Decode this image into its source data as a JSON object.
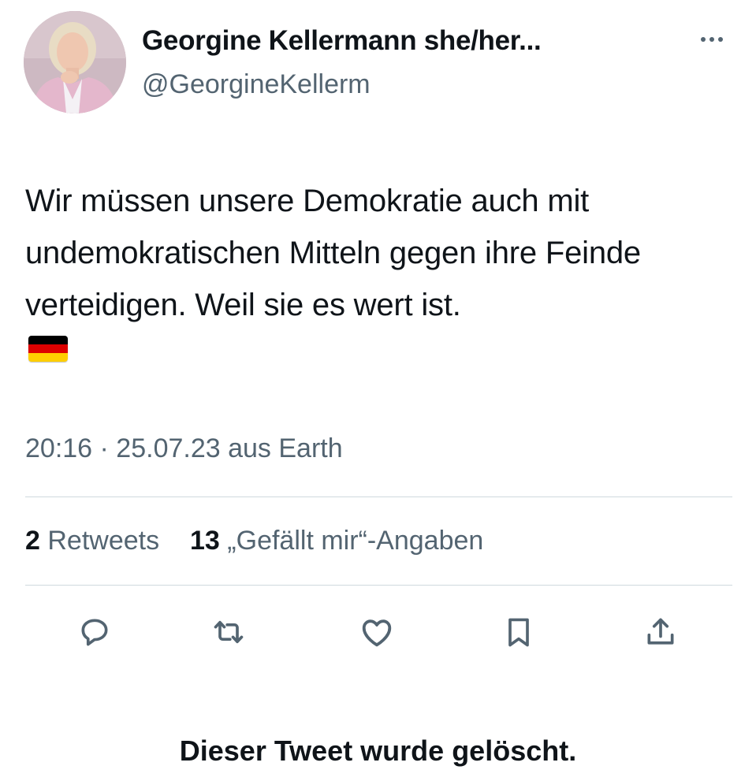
{
  "user": {
    "display_name": "Georgine Kellermann she/her...",
    "handle": "@GeorgineKellerm"
  },
  "tweet": {
    "text": "Wir müssen unsere Demokratie auch mit undemokratischen Mitteln gegen ihre Feinde verteidigen. Weil sie es wert ist.",
    "emoji": "flag-germany",
    "time_location": "20:16 · 25.07.23 aus Earth"
  },
  "stats": {
    "retweets_count": "2",
    "retweets_label": "Retweets",
    "likes_count": "13",
    "likes_label": "„Gefällt mir“-Angaben"
  },
  "actions": {
    "icons": [
      "reply-icon",
      "retweet-icon",
      "like-icon",
      "bookmark-icon",
      "share-icon"
    ]
  },
  "footer": {
    "deleted_notice": "Dieser Tweet wurde gelöscht."
  },
  "colors": {
    "primary_text": "#0f1419",
    "secondary_text": "#536471",
    "divider": "#cfd9de",
    "flag": [
      "#000000",
      "#dd0000",
      "#ffce00"
    ]
  }
}
